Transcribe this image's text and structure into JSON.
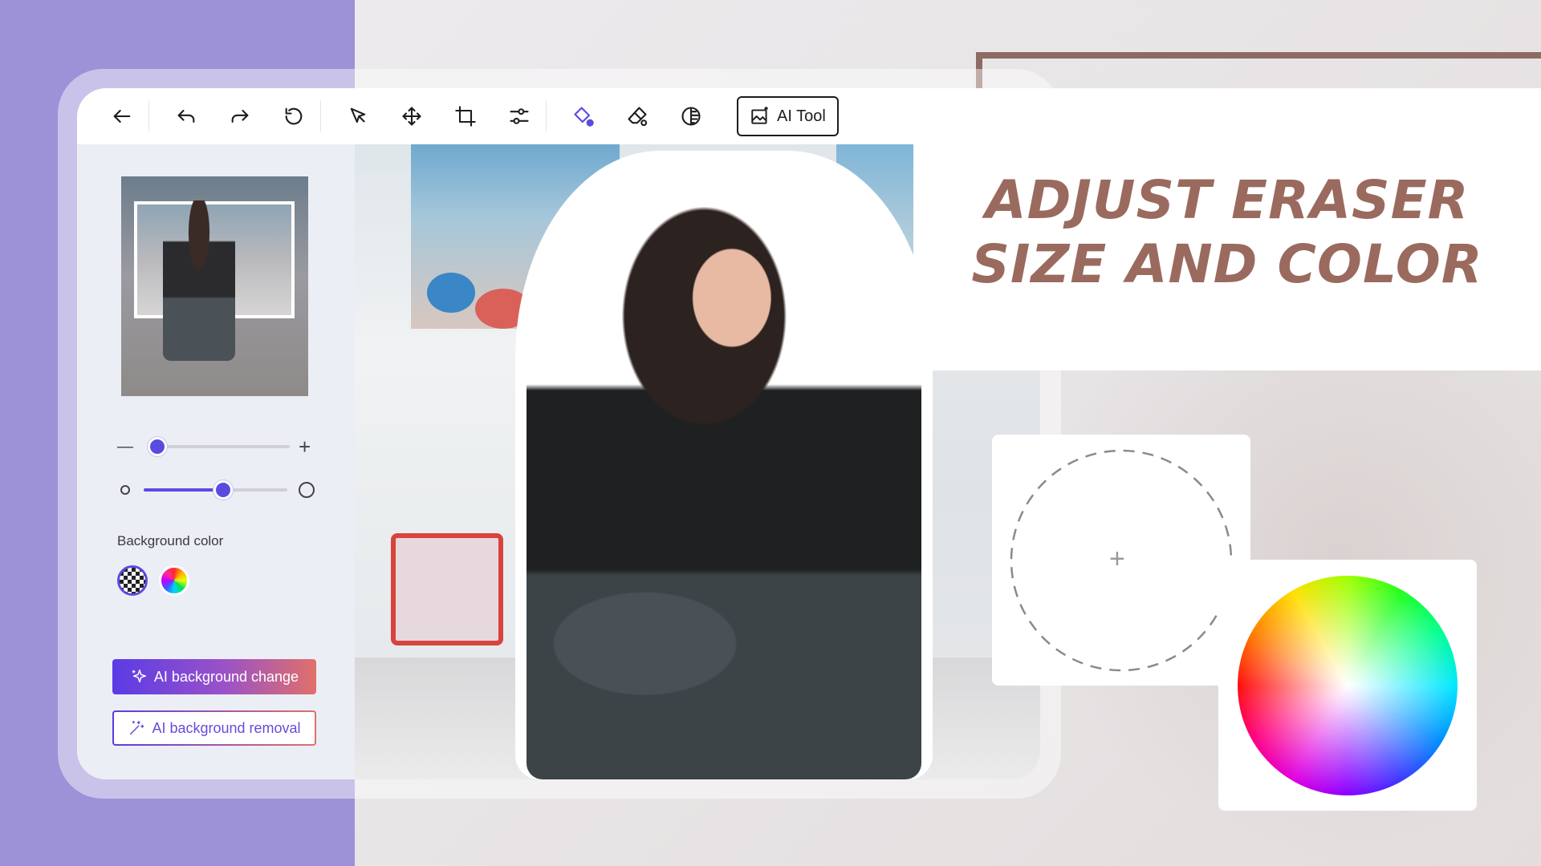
{
  "headline": {
    "line1": "ADJUST ERASER",
    "line2": "SIZE AND COLOR"
  },
  "toolbar": {
    "tools": [
      {
        "icon": "back-arrow-icon"
      },
      {
        "icon": "undo-icon"
      },
      {
        "icon": "redo-icon"
      },
      {
        "icon": "reset-icon"
      },
      {
        "icon": "select-cursor-icon"
      },
      {
        "icon": "move-icon"
      },
      {
        "icon": "crop-icon"
      },
      {
        "icon": "adjust-sliders-icon"
      },
      {
        "icon": "fill-color-icon",
        "active": true
      },
      {
        "icon": "eraser-icon"
      },
      {
        "icon": "contrast-icon"
      }
    ],
    "ai_tool_label": "AI Tool"
  },
  "side_panel": {
    "eraser_size": {
      "minus": "—",
      "plus": "+",
      "value": 0.08
    },
    "eraser_hardness": {
      "value": 0.56
    },
    "background_color_label": "Background color",
    "ai_change_label": "AI background change",
    "ai_removal_label": "AI background removal"
  },
  "eraser_preview": {
    "cursor": "+"
  },
  "colors": {
    "accent": "#5a4be0",
    "purple_band": "#9d92d8",
    "headline": "#9a6a5e",
    "frame_brown": "#8d6a62"
  }
}
